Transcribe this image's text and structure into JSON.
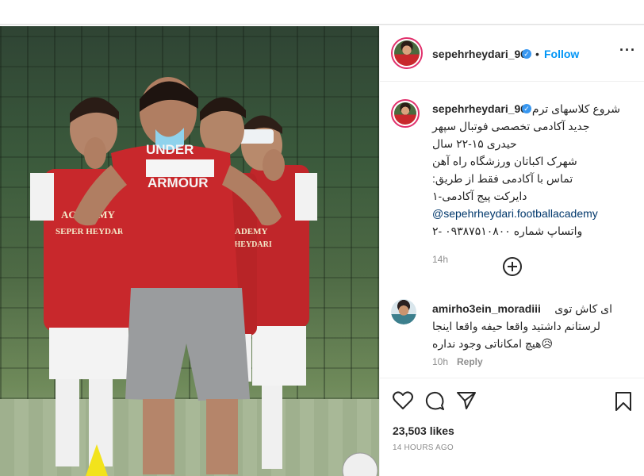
{
  "post": {
    "author": {
      "username": "sepehrheydari_96",
      "verified_icon": "verified-badge-icon",
      "follow_label": "Follow",
      "separator": "•"
    },
    "caption": {
      "lines": [
        "شروع کلاسهای ترم",
        "جدید آکادمی تخصصی فوتبال سپهر",
        "حیدری ۱۵-۲۲ سال",
        "شهرک اکباتان ورزشگاه راه آهن",
        "تماس با آکادمی فقط از طریق:",
        "دایرکت پیج آکادمی-۱"
      ],
      "mention": "@sepehrheydari.footballacademy",
      "last_line": "واتساپ شماره ۰۹۳۸۷۵۱۰۸۰۰ -۲",
      "time": "14h"
    },
    "comment": {
      "username": "amirho3ein_moradiii",
      "lines": [
        "ای کاش توی",
        "لرستانم داشتید واقعا حیفه واقعا اینجا",
        "😥هیچ امکاناتی وجود نداره"
      ],
      "time": "10h",
      "reply_label": "Reply"
    },
    "likes": "23,503 likes",
    "posted_ago": "14 HOURS AGO",
    "photo": {
      "shirt_text_1": "UNDER",
      "shirt_text_2": "ARMOUR",
      "bib_text_1": "ACADEMY",
      "bib_text_2": "SEPER HEYDARI",
      "bib_text_3": "ACADEMY",
      "bib_text_4": "HR HEYDARI"
    },
    "icons": [
      "verified-badge-icon",
      "more-options-icon",
      "load-more-comments-icon",
      "heart-icon",
      "comment-icon",
      "share-icon",
      "bookmark-icon"
    ],
    "colors": {
      "link": "#0095f6",
      "mention": "#00376b",
      "muted": "#8e8e8e",
      "jersey": "#c8282c",
      "verified": "#3897f0"
    }
  }
}
